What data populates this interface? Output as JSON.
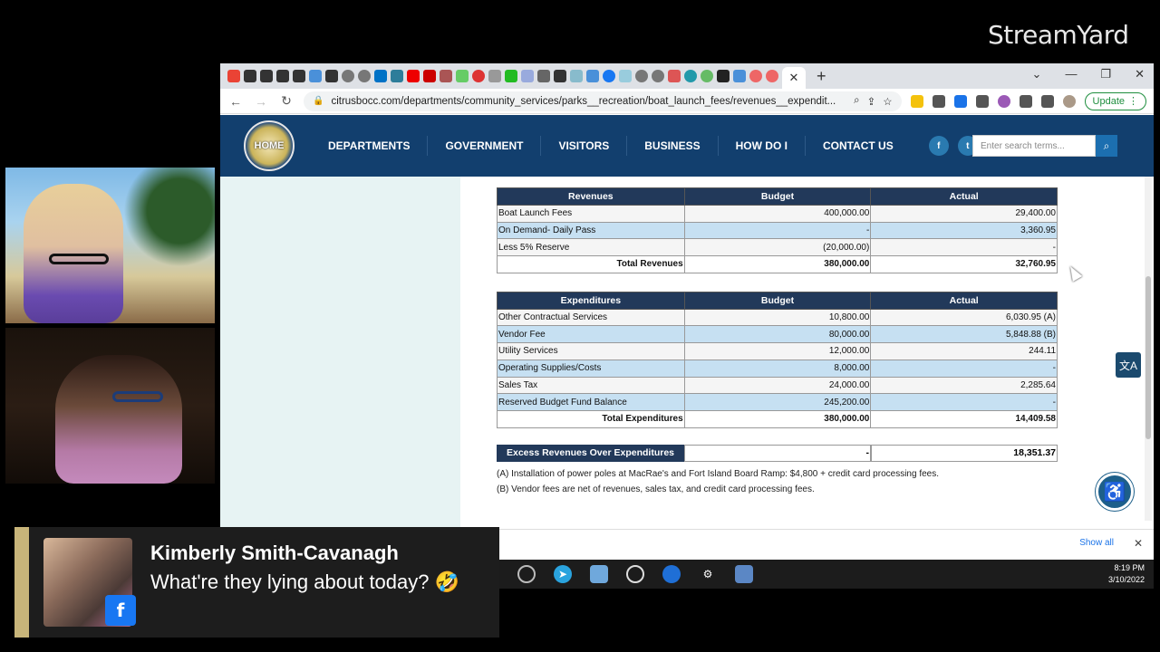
{
  "overlay": {
    "brand": "StreamYard"
  },
  "browser": {
    "url": "citrusbocc.com/departments/community_services/parks__recreation/boat_launch_fees/revenues__expendit...",
    "update_label": "Update",
    "tab_close": "✕",
    "new_tab": "+",
    "show_all": "Show all"
  },
  "site": {
    "logo_text": "HOME",
    "nav": [
      "DEPARTMENTS",
      "GOVERNMENT",
      "VISITORS",
      "BUSINESS",
      "HOW DO I",
      "CONTACT US"
    ],
    "search_placeholder": "Enter search terms..."
  },
  "revenues": {
    "headers": [
      "Revenues",
      "Budget",
      "Actual"
    ],
    "rows": [
      [
        "Boat Launch Fees",
        "400,000.00",
        "29,400.00"
      ],
      [
        "On Demand- Daily Pass",
        "-",
        "3,360.95"
      ],
      [
        "Less 5% Reserve",
        "(20,000.00)",
        "-"
      ]
    ],
    "total": [
      "Total Revenues",
      "380,000.00",
      "32,760.95"
    ]
  },
  "expenditures": {
    "headers": [
      "Expenditures",
      "Budget",
      "Actual"
    ],
    "rows": [
      [
        "Other Contractual Services",
        "10,800.00",
        "6,030.95 (A)"
      ],
      [
        "Vendor Fee",
        "80,000.00",
        "5,848.88 (B)"
      ],
      [
        "Utility Services",
        "12,000.00",
        "244.11"
      ],
      [
        "Operating Supplies/Costs",
        "8,000.00",
        "-"
      ],
      [
        "Sales Tax",
        "24,000.00",
        "2,285.64"
      ],
      [
        "Reserved Budget Fund Balance",
        "245,200.00",
        "-"
      ]
    ],
    "total": [
      "Total Expenditures",
      "380,000.00",
      "14,409.58"
    ]
  },
  "excess": {
    "label": "Excess Revenues Over Expenditures",
    "budget": "-",
    "actual": "18,351.37"
  },
  "notes": [
    "(A) Installation of power poles at MacRae's and Fort Island Board Ramp: $4,800 + credit card processing fees.",
    "(B) Vendor fees are net of revenues, sales tax, and credit card processing fees."
  ],
  "taskbar": {
    "time": "8:19 PM",
    "date": "3/10/2022"
  },
  "comment": {
    "name": "Kimberly Smith-Cavanagh",
    "message": "What're they lying about today? 🤣",
    "fb_glyph": "f"
  },
  "colors": {
    "nav_bg": "#123f6e",
    "table_header": "#22395a",
    "row_alt": "#c6e0f2",
    "facebook": "#1877f2"
  }
}
